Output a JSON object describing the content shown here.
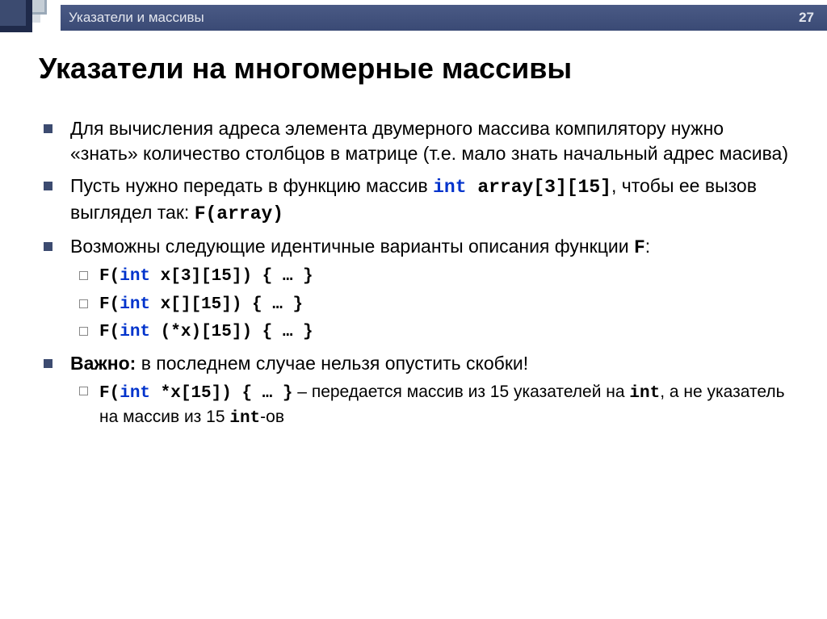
{
  "header": {
    "banner_title": "Указатели и массивы",
    "slide_number": "27"
  },
  "heading": "Указатели на многомерные массивы",
  "items": [
    {
      "text": "Для вычисления адреса элемента двумерного массива компилятору нужно «знать» количество столбцов в матрице (т.е. мало знать начальный адрес масива)"
    },
    {
      "pre": "Пусть нужно передать в функцию массив ",
      "code1_kw": "int",
      "code1_rest": " array[3][15]",
      "mid": ", чтобы ее вызов выглядел так: ",
      "code2": "F(array)"
    },
    {
      "pre": "Возможны следующие идентичные  варианты описания функции ",
      "code1": "F",
      "post": ":",
      "sub": [
        {
          "pre": "F(",
          "kw": "int",
          "rest": " x[3][15]) { … }"
        },
        {
          "pre": "F(",
          "kw": "int",
          "rest": " x[][15]) { … }"
        },
        {
          "pre": "F(",
          "kw": "int",
          "rest": " (*x)[15]) { … }"
        }
      ]
    },
    {
      "bold_pre": "Важно:",
      "post": " в последнем случае нельзя опустить скобки!",
      "sub": [
        {
          "pre": "F(",
          "kw": "int",
          "rest": " *x[15]) { … }",
          "tail_pre": " – передается массив из 15 указателей на ",
          "tail_code1": "int",
          "tail_mid": ", а не указатель на массив из 15 ",
          "tail_code2": "int",
          "tail_post": "-ов"
        }
      ]
    }
  ]
}
